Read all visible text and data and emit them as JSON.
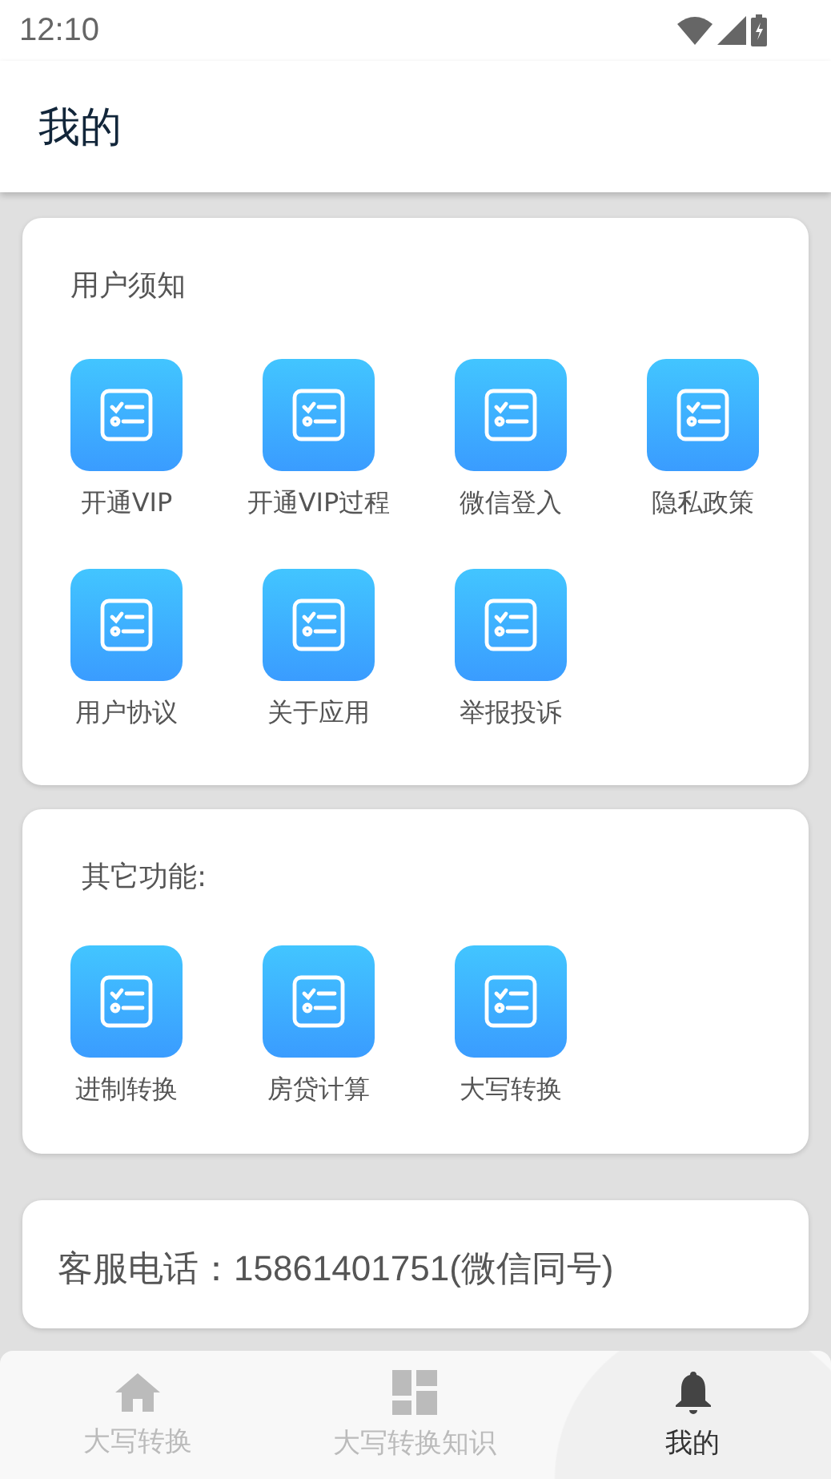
{
  "status_bar": {
    "time": "12:10"
  },
  "app_bar": {
    "title": "我的"
  },
  "sections": [
    {
      "title": "用户须知",
      "items": [
        {
          "label": "开通VIP"
        },
        {
          "label": "开通VIP过程"
        },
        {
          "label": "微信登入"
        },
        {
          "label": "隐私政策"
        },
        {
          "label": "用户协议"
        },
        {
          "label": "关于应用"
        },
        {
          "label": "举报投诉"
        }
      ]
    },
    {
      "title": "其它功能:",
      "items": [
        {
          "label": "进制转换"
        },
        {
          "label": "房贷计算"
        },
        {
          "label": "大写转换"
        }
      ]
    }
  ],
  "contact": {
    "text": "客服电话：15861401751(微信同号)"
  },
  "bottom_nav": [
    {
      "label": "大写转换",
      "kind": "home",
      "selected": false
    },
    {
      "label": "大写转换知识",
      "kind": "dashboard",
      "selected": false
    },
    {
      "label": "我的",
      "kind": "bell",
      "selected": true
    }
  ]
}
